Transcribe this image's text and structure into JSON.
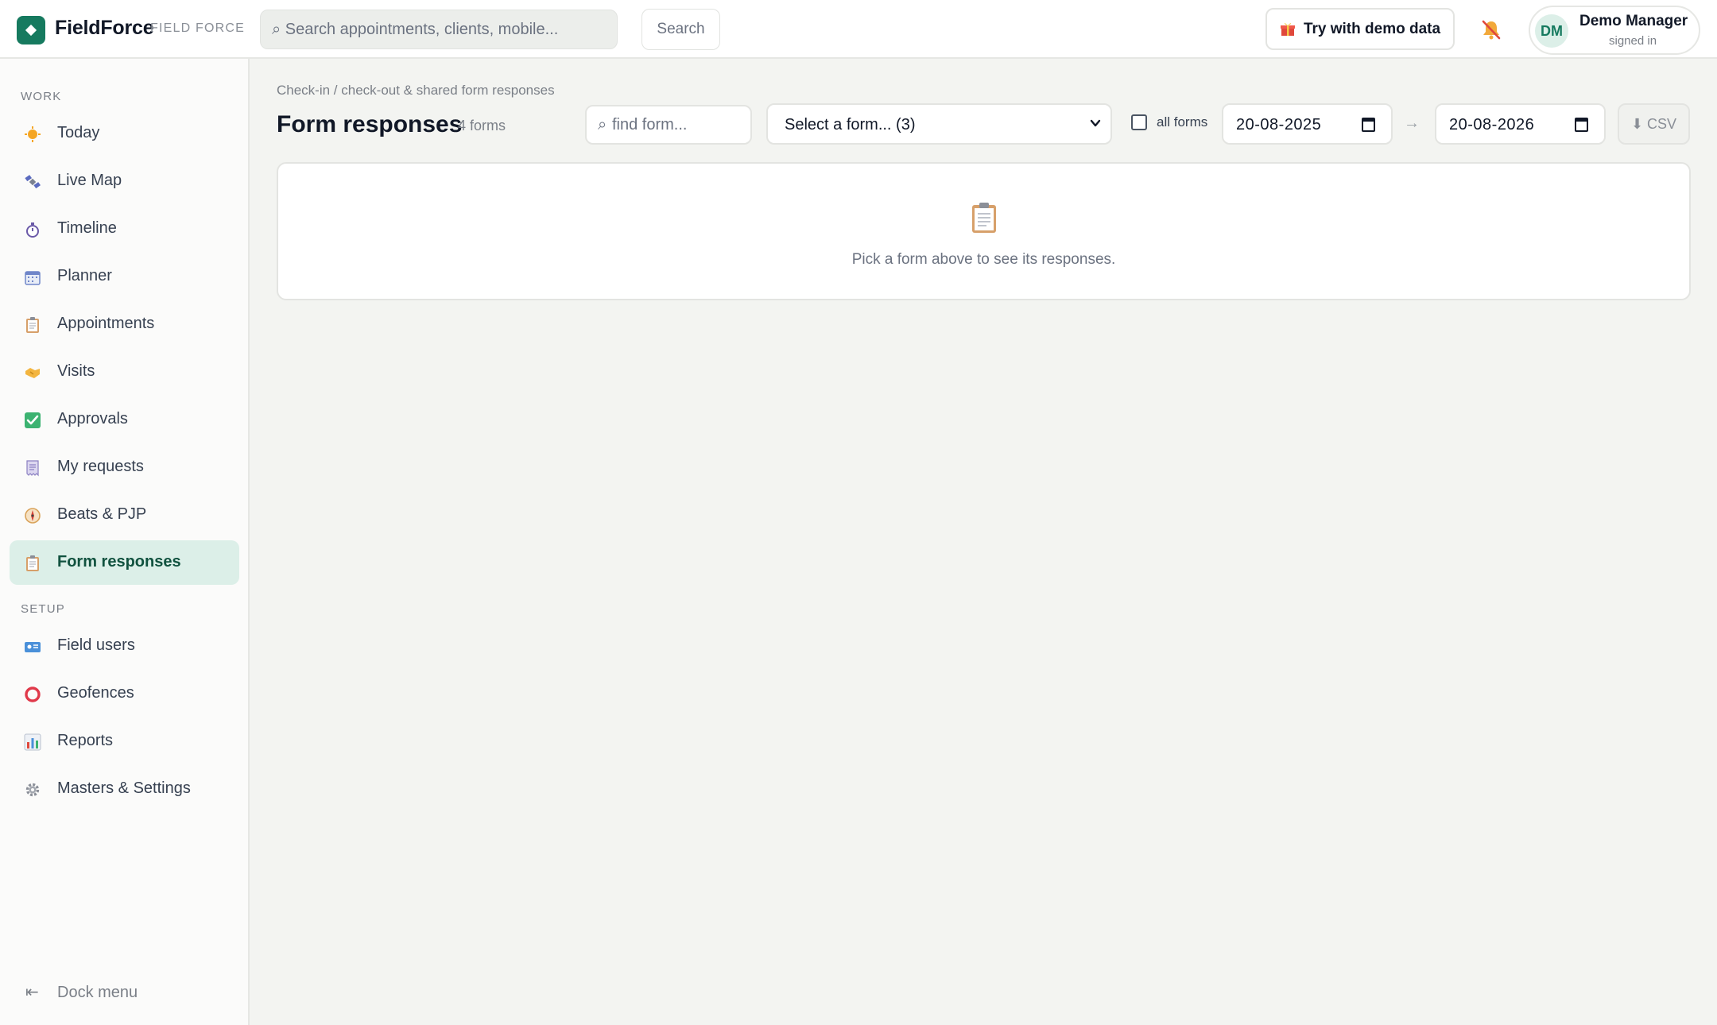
{
  "brand": {
    "name": "FieldForce",
    "tagline": "FIELD FORCE"
  },
  "header": {
    "search_placeholder": "⌕ Search appointments, clients, mobile...",
    "search_button": "Search",
    "demo_button": "Try with demo data",
    "notifications_icon": "bell-off-icon",
    "user": {
      "initials": "DM",
      "name": "Demo Manager",
      "status": "signed in"
    }
  },
  "sidebar": {
    "work_label": "WORK",
    "work_items": [
      {
        "label": "Today",
        "icon": "sun-icon"
      },
      {
        "label": "Live Map",
        "icon": "satellite-icon"
      },
      {
        "label": "Timeline",
        "icon": "stopwatch-icon"
      },
      {
        "label": "Planner",
        "icon": "calendar-icon"
      },
      {
        "label": "Appointments",
        "icon": "clipboard-icon"
      },
      {
        "label": "Visits",
        "icon": "handshake-icon"
      },
      {
        "label": "Approvals",
        "icon": "check-icon"
      },
      {
        "label": "My requests",
        "icon": "receipt-icon"
      },
      {
        "label": "Beats & PJP",
        "icon": "compass-icon"
      },
      {
        "label": "Form responses",
        "icon": "clipboard-icon",
        "active": true
      }
    ],
    "setup_label": "SETUP",
    "setup_items": [
      {
        "label": "Field users",
        "icon": "id-card-icon"
      },
      {
        "label": "Geofences",
        "icon": "circle-icon"
      },
      {
        "label": "Reports",
        "icon": "bar-chart-icon"
      },
      {
        "label": "Masters & Settings",
        "icon": "gear-icon"
      }
    ],
    "dock_label": "Dock menu"
  },
  "main": {
    "breadcrumb": "Check-in / check-out & shared form responses",
    "title": "Form responses",
    "count": "4 forms",
    "find_placeholder": "find form...",
    "select_value": "Select a form... (3)",
    "all_forms_label": "all forms",
    "date_from": "20-08-2025",
    "date_to": "20-08-2026",
    "range_arrow": "→",
    "csv_label": "⬇ CSV",
    "empty_message": "Pick a form above to see its responses."
  },
  "colors": {
    "brand": "#167a5f",
    "active_bg": "#dcefe8",
    "page_bg": "#f3f4f1"
  }
}
